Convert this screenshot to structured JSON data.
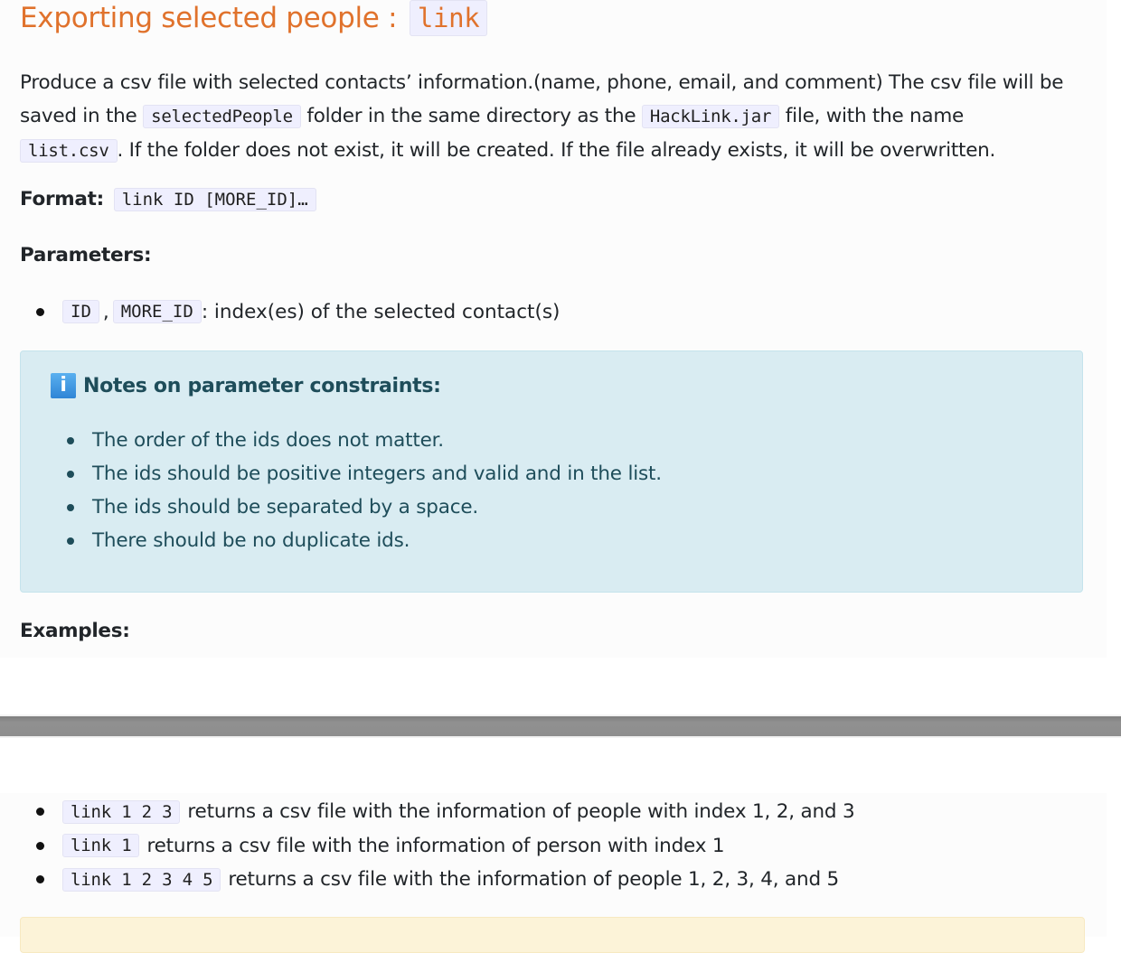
{
  "section": {
    "title": "Exporting selected people :",
    "command": "link"
  },
  "description": {
    "line1": "Produce a csv file with selected contacts’ information.(name, phone, email, and comment) The csv file will be",
    "line2_pre": "saved in the",
    "folder": "selectedPeople",
    "line2_mid": "folder in the same directory as the",
    "jar": "HackLink.jar",
    "line2_post": "file, with the name",
    "filename": "list.csv",
    "line3_post": ". If the folder does not exist, it will be created. If the file already exists, it will be overwritten."
  },
  "format": {
    "label": "Format:",
    "value": "link ID [MORE_ID]…"
  },
  "parameters": {
    "heading": "Parameters:",
    "items": [
      {
        "codes": [
          "ID",
          "MORE_ID"
        ],
        "separator": ",",
        "text": ": index(es) of the selected contact(s)"
      }
    ]
  },
  "note": {
    "icon": "info-icon",
    "heading": "Notes on parameter constraints:",
    "items": [
      "The order of the ids does not matter.",
      "The ids should be positive integers and valid and in the list.",
      "The ids should be separated by a space.",
      "There should be no duplicate ids."
    ]
  },
  "examples": {
    "heading": "Examples:",
    "items": [
      {
        "code": "link 1 2 3",
        "text": "returns a csv file with the information of people with index 1, 2, and 3"
      },
      {
        "code": "link 1",
        "text": "returns a csv file with the information of person with index 1"
      },
      {
        "code": "link 1 2 3 4 5",
        "text": "returns a csv file with the information of people 1, 2, 3, 4, and 5"
      }
    ]
  },
  "colors": {
    "heading": "#e0722c",
    "code_background": "#efeffe",
    "note_background": "#d9ecf2",
    "note_text": "#1e4d5a",
    "warning_background": "#fcf3d8",
    "page_break": "#8e8e8e"
  }
}
